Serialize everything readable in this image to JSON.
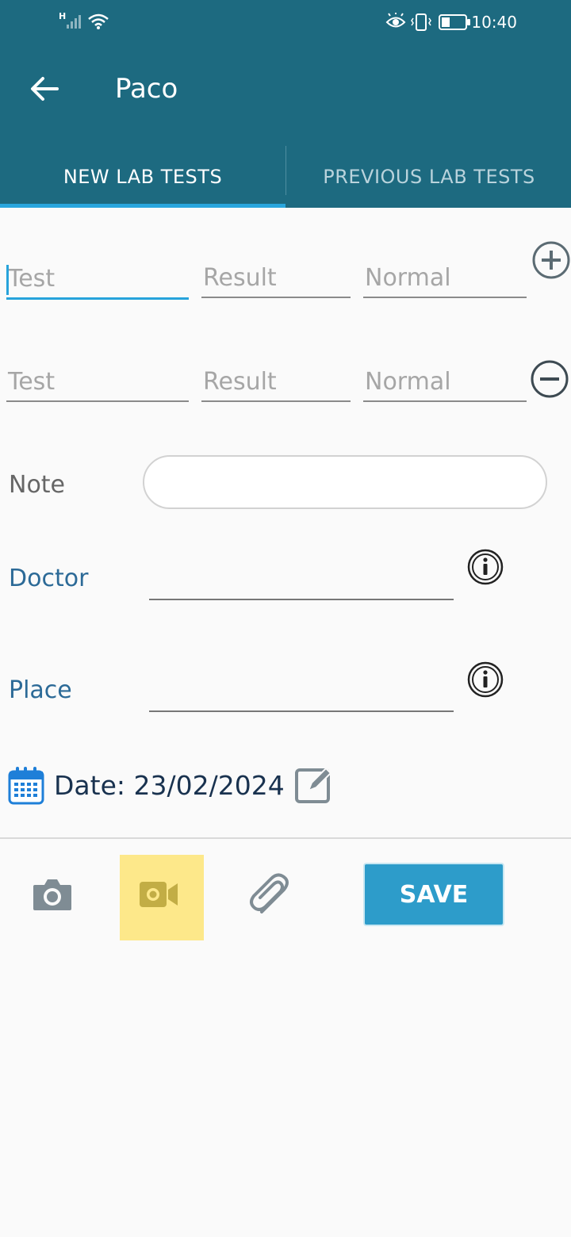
{
  "status_bar": {
    "time": "10:40",
    "network": "H"
  },
  "header": {
    "title": "Paco"
  },
  "tabs": [
    {
      "label": "NEW LAB TESTS",
      "selected": true
    },
    {
      "label": "PREVIOUS LAB TESTS",
      "selected": false
    }
  ],
  "test_rows": [
    {
      "test_placeholder": "Test",
      "result_placeholder": "Result",
      "normal_placeholder": "Normal",
      "action": "add-icon"
    },
    {
      "test_placeholder": "Test",
      "result_placeholder": "Result",
      "normal_placeholder": "Normal",
      "action": "remove-icon"
    }
  ],
  "note": {
    "label": "Note",
    "value": ""
  },
  "doctor": {
    "label": "Doctor",
    "value": ""
  },
  "place": {
    "label": "Place",
    "value": ""
  },
  "date": {
    "text": "Date: 23/02/2024"
  },
  "toolbar": {
    "save_label": "SAVE",
    "icons": [
      "camera-icon",
      "video-icon",
      "paperclip-icon"
    ],
    "highlight_color": "#fde88a"
  },
  "colors": {
    "appbar": "#1d6a80",
    "accent": "#29a6dd",
    "save_button": "#2d9cca"
  }
}
